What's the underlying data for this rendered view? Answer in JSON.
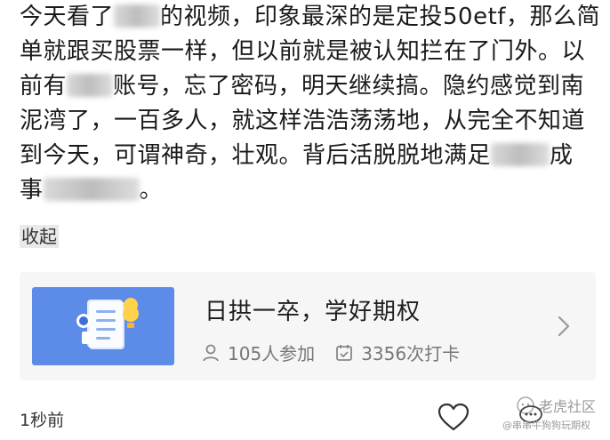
{
  "post": {
    "line1_a": "今天看了",
    "line1_b": "的视频，印象最深的是定投50etf，那么简",
    "line2": "单就跟买股票一样，但以前就是被认知拦在了门外。以",
    "line3_a": "前有",
    "line3_b": "账号，忘了密码，明天继续搞。隐约感觉到南",
    "line4": "泥湾了，一百多人，就这样浩浩荡荡地，从完全不知道",
    "line5_a": "到今天，可谓神奇，壮观。背后活脱脱地满足",
    "line5_b": "成",
    "line6_a": "事",
    "line6_b": "。",
    "collapse_label": "收起"
  },
  "card": {
    "title": "日拱一卒，学好期权",
    "participants": "105人参加",
    "checkins": "3356次打卡"
  },
  "footer": {
    "time": "1秒前"
  },
  "watermark": {
    "logo_text": "老虎社区",
    "handle": "@串串牛狗狗玩期权"
  },
  "colors": {
    "thumb_bg": "#5d8be8",
    "card_bg": "#f6f6f6"
  }
}
